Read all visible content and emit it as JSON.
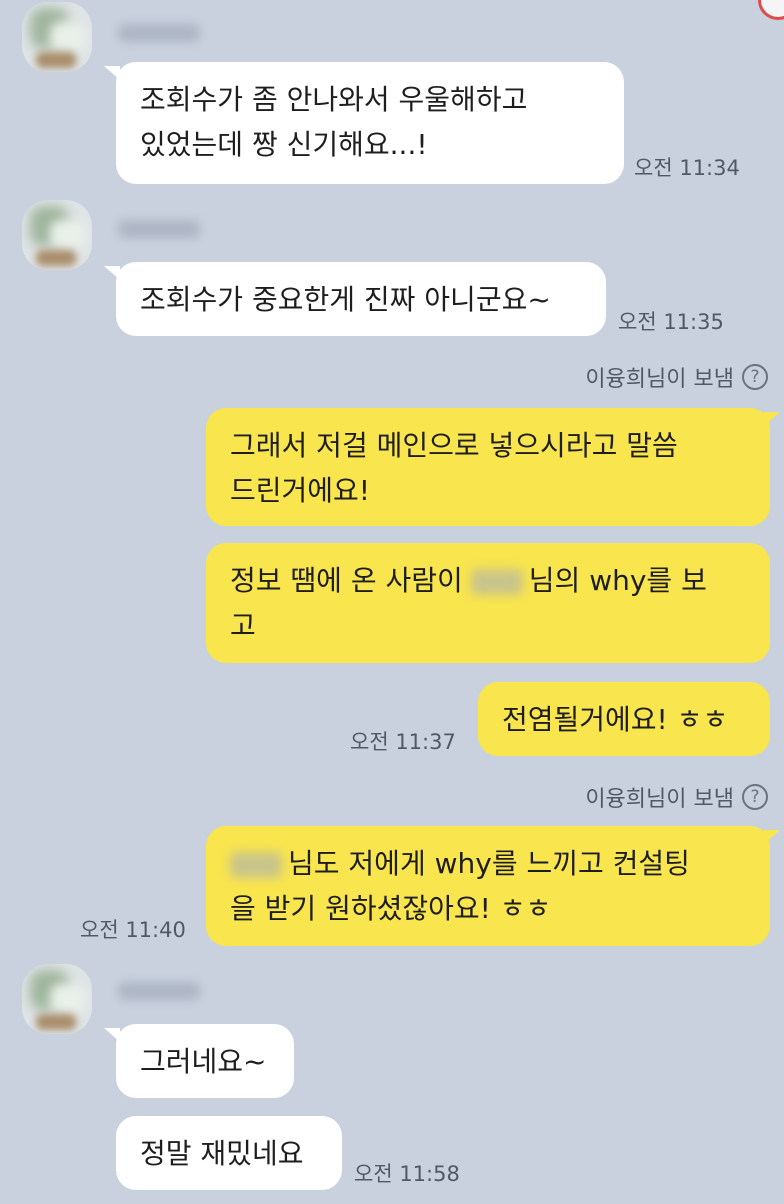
{
  "messages": [
    {
      "type": "received",
      "lines": [
        "조회수가 좀 안나와서 우울해하고",
        "있었는데 짱 신기해요...!"
      ],
      "time": "오전 11:34"
    },
    {
      "type": "received",
      "lines": [
        "조회수가 중요한게 진짜 아니군요~"
      ],
      "time": "오전 11:35"
    },
    {
      "type": "sent_by",
      "label": "이융희님이 보냄"
    },
    {
      "type": "sent",
      "lines": [
        "그래서 저걸 메인으로 넣으시라고 말씀",
        "드린거에요!"
      ]
    },
    {
      "type": "sent",
      "line1_before": "정보 땜에 온 사람이",
      "line1_after": "님의 why를 보",
      "line2": "고"
    },
    {
      "type": "sent",
      "lines": [
        "전염될거에요! ㅎㅎ"
      ],
      "time": "오전 11:37"
    },
    {
      "type": "sent_by",
      "label": "이융희님이 보냄"
    },
    {
      "type": "sent",
      "line1_after": "님도 저에게 why를 느끼고 컨설팅",
      "line2": "을 받기 원하셨잖아요! ㅎㅎ",
      "time": "오전 11:40"
    },
    {
      "type": "received",
      "lines": [
        "그러네요~"
      ]
    },
    {
      "type": "received",
      "lines": [
        "정말 재밌네요"
      ],
      "time": "오전 11:58"
    }
  ],
  "help_icon": "question-circle-icon",
  "help_glyph": "?",
  "colors": {
    "background": "#c9d1de",
    "received_bubble": "#ffffff",
    "sent_bubble": "#f9e54e",
    "meta_text": "#505a66"
  }
}
